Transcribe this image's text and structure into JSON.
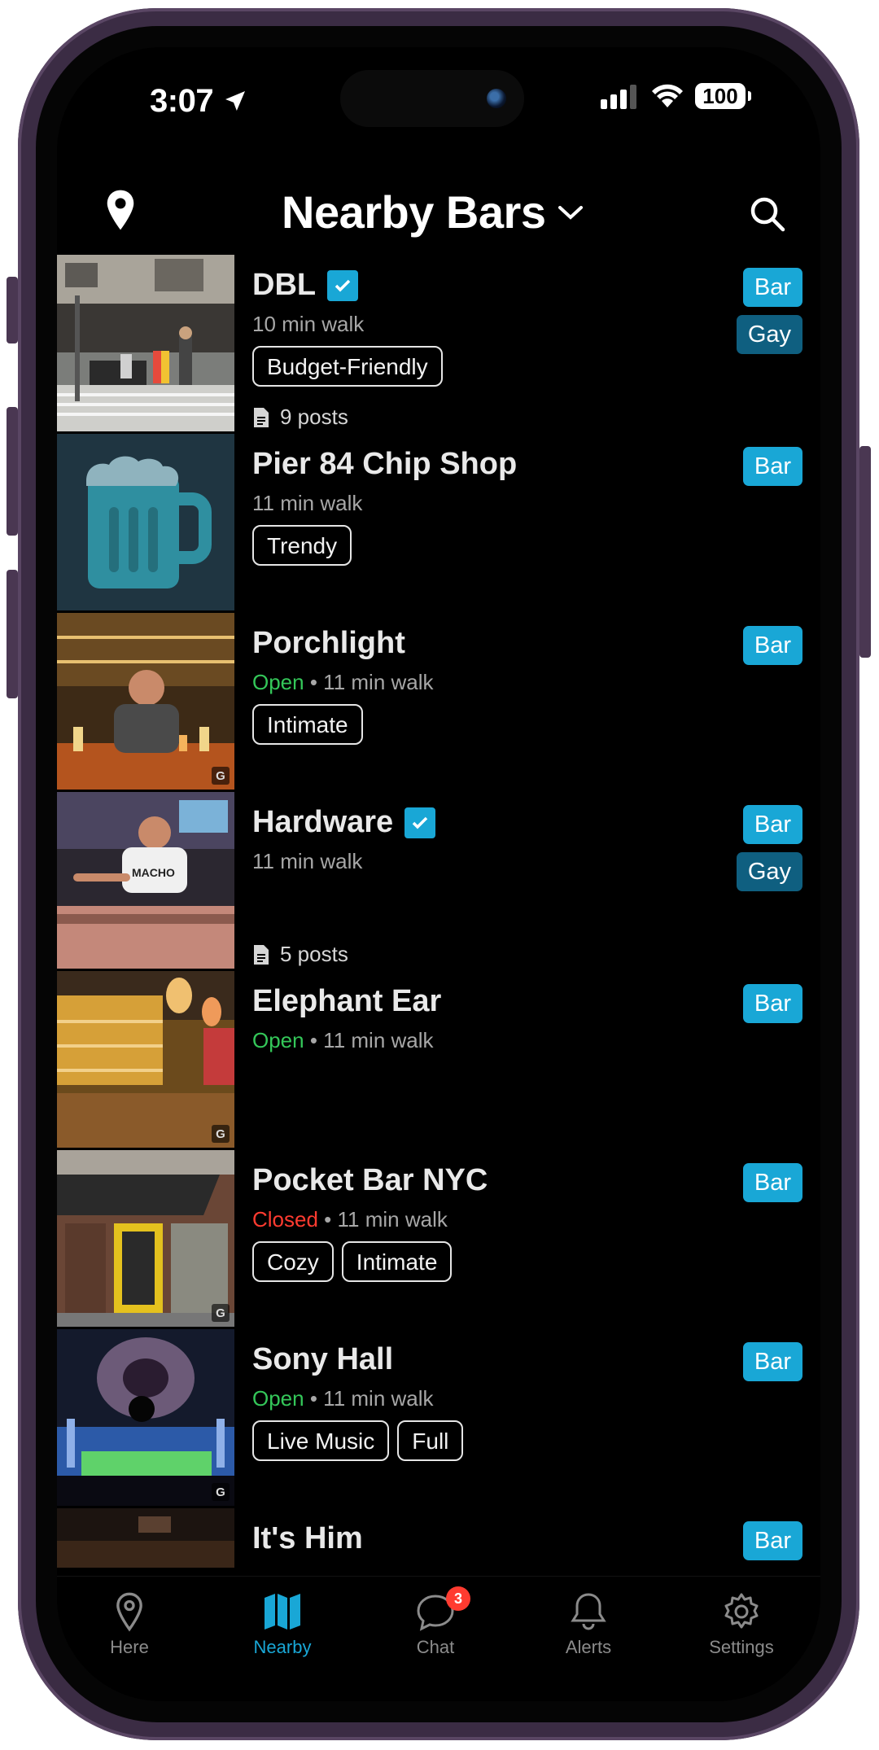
{
  "status": {
    "time": "3:07",
    "battery": "100"
  },
  "header": {
    "title": "Nearby Bars"
  },
  "places": [
    {
      "name": "DBL",
      "verified": true,
      "status": "",
      "walk": "10 min walk",
      "tags": [
        "Budget-Friendly"
      ],
      "categories": [
        "Bar",
        "Gay"
      ],
      "posts": "9 posts",
      "google": false
    },
    {
      "name": "Pier 84 Chip Shop",
      "verified": false,
      "status": "",
      "walk": "11 min walk",
      "tags": [
        "Trendy"
      ],
      "categories": [
        "Bar"
      ],
      "posts": "",
      "google": false
    },
    {
      "name": "Porchlight",
      "verified": false,
      "status": "Open",
      "walk": "11 min walk",
      "tags": [
        "Intimate"
      ],
      "categories": [
        "Bar"
      ],
      "posts": "",
      "google": true
    },
    {
      "name": "Hardware",
      "verified": true,
      "status": "",
      "walk": "11 min walk",
      "tags": [],
      "categories": [
        "Bar",
        "Gay"
      ],
      "posts": "5 posts",
      "google": false
    },
    {
      "name": "Elephant Ear",
      "verified": false,
      "status": "Open",
      "walk": "11 min walk",
      "tags": [],
      "categories": [
        "Bar"
      ],
      "posts": "",
      "google": true
    },
    {
      "name": "Pocket Bar NYC",
      "verified": false,
      "status": "Closed",
      "walk": "11 min walk",
      "tags": [
        "Cozy",
        "Intimate"
      ],
      "categories": [
        "Bar"
      ],
      "posts": "",
      "google": true
    },
    {
      "name": "Sony Hall",
      "verified": false,
      "status": "Open",
      "walk": "11 min walk",
      "tags": [
        "Live Music",
        "Full"
      ],
      "categories": [
        "Bar"
      ],
      "posts": "",
      "google": true
    },
    {
      "name": "It's Him",
      "verified": false,
      "status": "",
      "walk": "",
      "tags": [],
      "categories": [
        "Bar"
      ],
      "posts": "",
      "google": false
    }
  ],
  "tabs": [
    {
      "label": "Here",
      "icon": "pin-icon",
      "active": false
    },
    {
      "label": "Nearby",
      "icon": "map-icon",
      "active": true
    },
    {
      "label": "Chat",
      "icon": "chat-icon",
      "active": false,
      "badge": "3"
    },
    {
      "label": "Alerts",
      "icon": "bell-icon",
      "active": false
    },
    {
      "label": "Settings",
      "icon": "gear-icon",
      "active": false
    }
  ],
  "colors": {
    "accent": "#19a7d6",
    "gay": "#0f5f80",
    "open": "#34c759",
    "closed": "#ff3b30"
  },
  "icons": {
    "verified": "verified-check-icon",
    "posts": "document-icon",
    "google": "google-badge"
  }
}
